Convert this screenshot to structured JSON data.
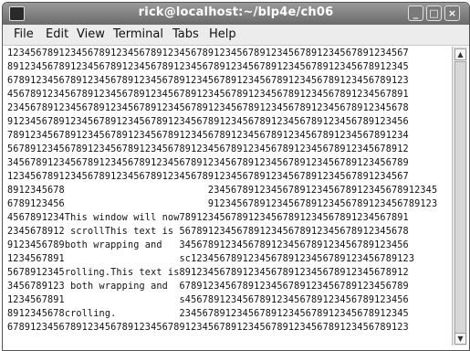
{
  "window": {
    "title": "rick@localhost:~/blp4e/ch06"
  },
  "menu": [
    "File",
    "Edit",
    "View",
    "Terminal",
    "Tabs",
    "Help"
  ],
  "lines": [
    "1234567891234567891234567891234567891234567891234567891234567891234567",
    "8912345678912345678912345678912345678912345678912345678912345678912345",
    "6789123456789123456789123456789123456789123456789123456789123456789123",
    "4567891234567891234567891234567891234567891234567891234567891234567891",
    "2345678912345678912345678912345678912345678912345678912345678912345678",
    "9123456789123456789123456789123456789123456789123456789123456789123456",
    "7891234567891234567891234567891234567891234567891234567891234567891234",
    "5678912345678912345678912345678912345678912345678912345678912345678912",
    "3456789123456789123456789123456789123456789123456789123456789123456789",
    "1234567891234567891234567891234567891234567891234567891234567891234567",
    "8912345678                         2345678912345678912345678912345678912345",
    "6789123456                         9123456789123456789123456789123456789123",
    "4567891234This window will now7891234567891234567891234567891234567891",
    "2345678912 scrollThis text is 5678912345678912345678912345678912345678",
    "9123456789both wrapping and   3456789123456789123456789123456789123456",
    "1234567891                    sc123456789123456789123456789123456789123",
    "5678912345rolling.This text is8912345678912345678912345678912345678912",
    "3456789123 both wrapping and  6789123456789123456789123456789123456789",
    "1234567891                    s456789123456789123456789123456789123456",
    "8912345678crolling.           2345678912345678912345678912345678912345",
    "6789123456789123456789123456789123456789123456789123456789123456789123"
  ],
  "scrollbar": {
    "up": "▲",
    "down": "▼"
  },
  "buttons": {
    "minimize": "_",
    "maximize": "□",
    "close": "×"
  }
}
